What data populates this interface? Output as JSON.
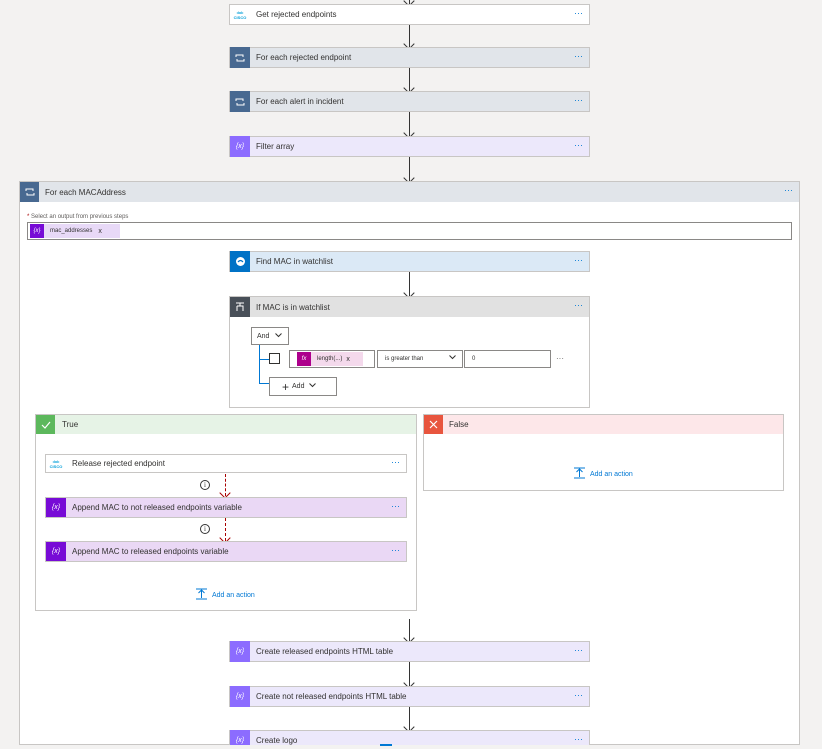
{
  "steps": {
    "get_rejected": "Get rejected endpoints",
    "for_each_rejected": "For each rejected endpoint",
    "for_each_alert": "For each alert in incident",
    "filter_array": "Filter array",
    "for_each_mac": "For each MACAddress",
    "select_output_label": "Select an output from previous steps",
    "mac_token": "mac_addresses",
    "find_mac": "Find MAC in watchlist",
    "if_mac": "If MAC is in watchlist",
    "and_label": "And",
    "length_token": "length(...)",
    "operator": "is greater than",
    "value": "0",
    "add_label": "Add",
    "true_label": "True",
    "false_label": "False",
    "release": "Release rejected endpoint",
    "append_not_released": "Append MAC to not released endpoints variable",
    "append_released": "Append MAC to released endpoints variable",
    "add_action": "Add an action",
    "create_released": "Create released endpoints HTML table",
    "create_not_released": "Create not released endpoints HTML table",
    "create_logo": "Create logo"
  },
  "ui": {
    "more": "···",
    "close_x": "x",
    "required_star": "*",
    "info_glyph": "i",
    "cisco_text": "CISCO",
    "var_glyph": "{x}",
    "fx_glyph": "fx"
  },
  "colors": {
    "control_blue": "#486991",
    "variable_purple": "#770bd6",
    "data_ops": "#8c6cff",
    "watchlist_blue": "#0072c6",
    "condition_gray": "#484f58",
    "true_green": "#5cb85c",
    "false_red": "#e8553e"
  },
  "icons": [
    "cisco-logo",
    "loop-icon",
    "data-operations-icon",
    "variable-icon",
    "sentinel-icon",
    "condition-icon",
    "check-icon",
    "close-icon",
    "add-action-icon"
  ]
}
